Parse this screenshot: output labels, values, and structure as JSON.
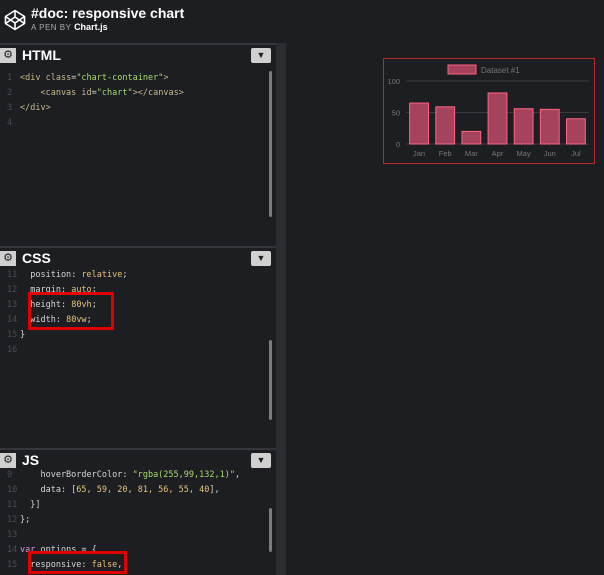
{
  "header": {
    "title": "#doc: responsive chart",
    "pen_by": "A PEN BY",
    "author": "Chart.js"
  },
  "editors": {
    "html": {
      "title": "HTML",
      "lines": [
        {
          "num": "1",
          "parts": [
            {
              "t": "<div ",
              "c": "tag"
            },
            {
              "t": "class",
              "c": "attr"
            },
            {
              "t": "=",
              "c": "code"
            },
            {
              "t": "\"chart-container\"",
              "c": "str"
            },
            {
              "t": ">",
              "c": "tag"
            }
          ]
        },
        {
          "num": "2",
          "parts": [
            {
              "t": "    <canvas ",
              "c": "tag"
            },
            {
              "t": "id",
              "c": "attr"
            },
            {
              "t": "=",
              "c": "code"
            },
            {
              "t": "\"chart\"",
              "c": "str"
            },
            {
              "t": "></canvas>",
              "c": "tag"
            }
          ]
        },
        {
          "num": "3",
          "parts": [
            {
              "t": "</div>",
              "c": "tag"
            }
          ]
        },
        {
          "num": "4",
          "parts": []
        }
      ]
    },
    "css": {
      "title": "CSS",
      "lines": [
        {
          "num": "11",
          "parts": [
            {
              "t": "  position",
              "c": "prop"
            },
            {
              "t": ": ",
              "c": "code"
            },
            {
              "t": "relative",
              "c": "val"
            },
            {
              "t": ";",
              "c": "code"
            }
          ]
        },
        {
          "num": "12",
          "parts": [
            {
              "t": "  margin",
              "c": "prop"
            },
            {
              "t": ": ",
              "c": "code"
            },
            {
              "t": "auto",
              "c": "val"
            },
            {
              "t": ";",
              "c": "code"
            }
          ]
        },
        {
          "num": "13",
          "parts": [
            {
              "t": "  height",
              "c": "prop"
            },
            {
              "t": ": ",
              "c": "code"
            },
            {
              "t": "80vh",
              "c": "val"
            },
            {
              "t": ";",
              "c": "code"
            }
          ]
        },
        {
          "num": "14",
          "parts": [
            {
              "t": "  width",
              "c": "prop"
            },
            {
              "t": ": ",
              "c": "code"
            },
            {
              "t": "80vw",
              "c": "val"
            },
            {
              "t": ";",
              "c": "code"
            }
          ]
        },
        {
          "num": "15",
          "parts": [
            {
              "t": "}",
              "c": "code"
            }
          ]
        },
        {
          "num": "16",
          "parts": []
        }
      ]
    },
    "js": {
      "title": "JS",
      "lines": [
        {
          "num": "9",
          "parts": [
            {
              "t": "    hoverBorderColor: ",
              "c": "prop"
            },
            {
              "t": "\"rgba(255,99,132,1)\"",
              "c": "str"
            },
            {
              "t": ",",
              "c": "code"
            }
          ]
        },
        {
          "num": "10",
          "parts": [
            {
              "t": "    data: [",
              "c": "prop"
            },
            {
              "t": "65, 59, 20, 81, 56, 55, 40",
              "c": "val"
            },
            {
              "t": "],",
              "c": "code"
            }
          ]
        },
        {
          "num": "11",
          "parts": [
            {
              "t": "  }]",
              "c": "code"
            }
          ]
        },
        {
          "num": "12",
          "parts": [
            {
              "t": "};",
              "c": "code"
            }
          ]
        },
        {
          "num": "13",
          "parts": []
        },
        {
          "num": "14",
          "parts": [
            {
              "t": "var ",
              "c": "kw"
            },
            {
              "t": "options = {",
              "c": "code"
            }
          ]
        },
        {
          "num": "15",
          "parts": [
            {
              "t": "  responsive: ",
              "c": "prop"
            },
            {
              "t": "false",
              "c": "val"
            },
            {
              "t": ",",
              "c": "code"
            }
          ]
        }
      ]
    }
  },
  "chart_data": {
    "type": "bar",
    "categories": [
      "Jan",
      "Feb",
      "Mar",
      "Apr",
      "May",
      "Jun",
      "Jul"
    ],
    "series": [
      {
        "name": "Dataset #1",
        "values": [
          65,
          59,
          20,
          81,
          56,
          55,
          40
        ]
      }
    ],
    "yticks": [
      0,
      50,
      100
    ],
    "ylim": [
      0,
      100
    ],
    "legend": "top",
    "grid": true,
    "colors": {
      "fill": "#a4435b",
      "stroke": "#ff6384",
      "grid": "#3a3b40",
      "text": "#777777"
    }
  }
}
